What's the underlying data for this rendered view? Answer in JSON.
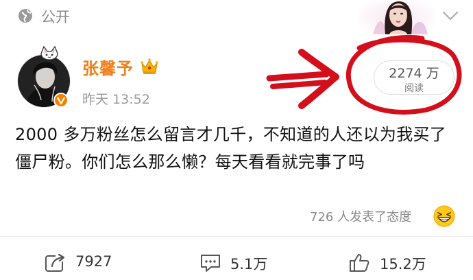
{
  "header": {
    "visibility_label": "公开",
    "icons": [
      "globe-icon",
      "portrait-thumbnail",
      "chevron-down-icon"
    ]
  },
  "post": {
    "author": "张馨予",
    "badge": "crown-icon",
    "verified_badge": "verified-v-icon",
    "time": "昨天 13:52",
    "views": {
      "count": "2274 万",
      "label": "阅读"
    },
    "text": "2000 多万粉丝怎么留言才几千，不知道的人还以为我买了僵尸粉。你们怎么那么懒？每天看看就完事了吗",
    "reactions_text": "726 人发表了态度",
    "reaction_emoji": "laughing-emoji"
  },
  "actions": {
    "reposts": "7927",
    "comments": "5.1万",
    "likes": "15.2万"
  },
  "annotation": {
    "color": "#d40f1c",
    "shapes": [
      "arrow",
      "circle"
    ]
  },
  "colors": {
    "author": "#ef7f1a",
    "meta": "#9a9a9a",
    "text": "#111111"
  }
}
